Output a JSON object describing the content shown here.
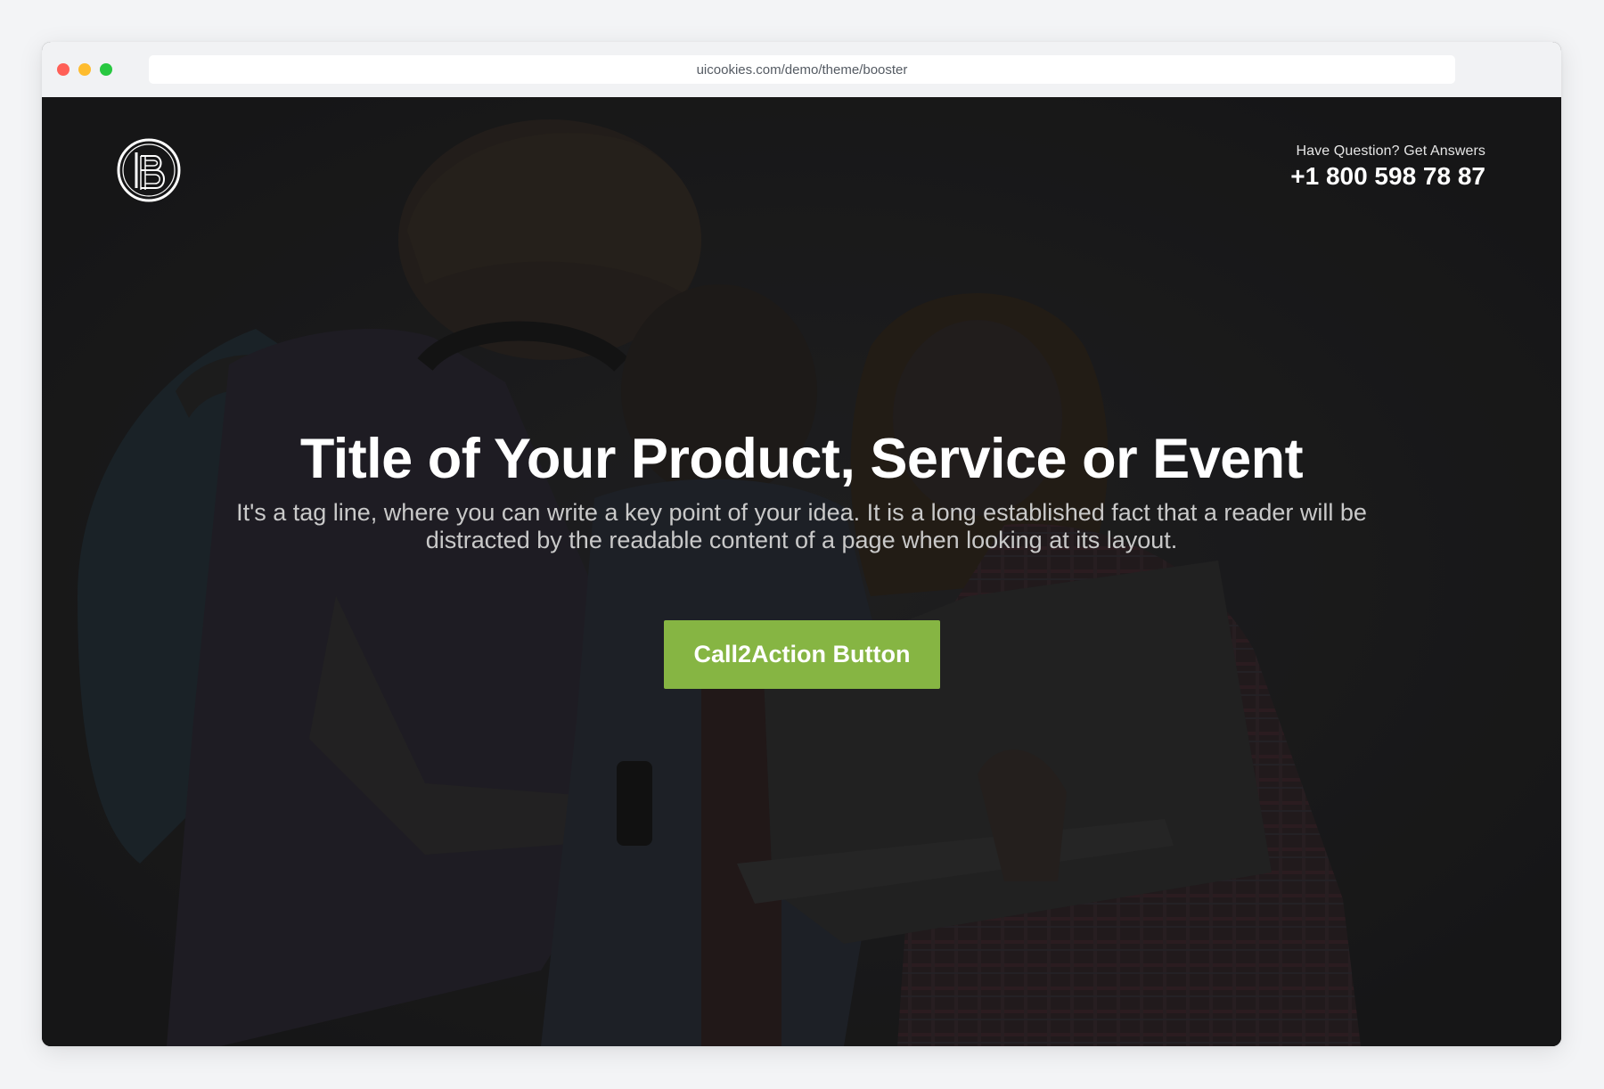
{
  "browser": {
    "url": "uicookies.com/demo/theme/booster"
  },
  "header": {
    "logo_icon": "b-monogram-logo-icon",
    "question_text": "Have Question? Get Answers",
    "phone": "+1 800 598 78 87"
  },
  "hero": {
    "title": "Title of Your Product, Service or Event",
    "tagline": "It's a tag line, where you can write a key point of your idea. It is a long established fact that a reader will be distracted by the readable content of a page when looking at its layout.",
    "cta_label": "Call2Action Button"
  },
  "colors": {
    "cta_background": "#86b543",
    "hero_overlay": "#1d1d1f",
    "text_primary": "#ffffff"
  }
}
